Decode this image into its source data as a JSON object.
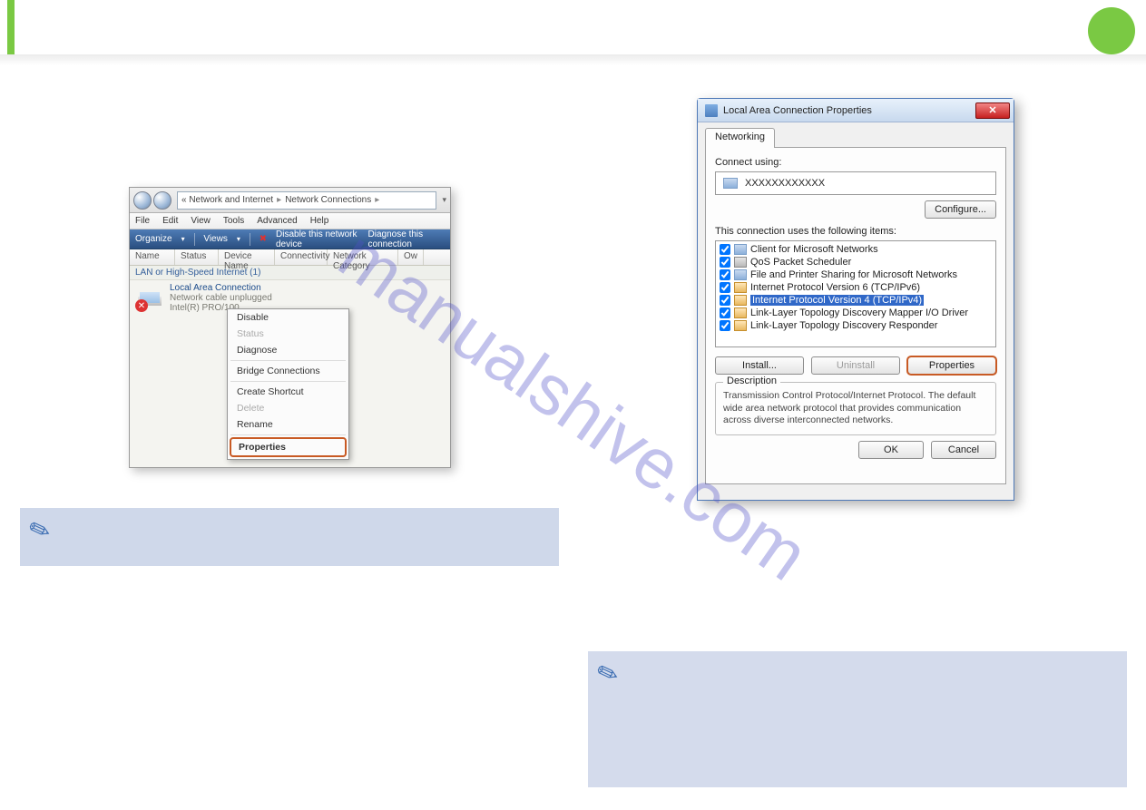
{
  "watermark": "manualshive.com",
  "left_window": {
    "breadcrumb": [
      "« Network and Internet",
      "Network Connections"
    ],
    "menus": [
      "File",
      "Edit",
      "View",
      "Tools",
      "Advanced",
      "Help"
    ],
    "toolbar": {
      "organize": "Organize",
      "views": "Views",
      "disable": "Disable this network device",
      "diagnose": "Diagnose this connection"
    },
    "columns": [
      "Name",
      "Status",
      "Device Name",
      "Connectivity",
      "Network Category",
      "Ow"
    ],
    "group": "LAN or High-Speed Internet (1)",
    "connection": {
      "name": "Local Area Connection",
      "status": "Network cable unplugged",
      "device": "Intel(R) PRO/100"
    },
    "context_menu": {
      "disable": "Disable",
      "status": "Status",
      "diagnose": "Diagnose",
      "bridge": "Bridge Connections",
      "shortcut": "Create Shortcut",
      "delete": "Delete",
      "rename": "Rename",
      "properties": "Properties"
    }
  },
  "dialog": {
    "title": "Local Area Connection Properties",
    "tab": "Networking",
    "connect_using_label": "Connect using:",
    "adapter": "XXXXXXXXXXXX",
    "configure": "Configure...",
    "items_label": "This connection uses the following items:",
    "items": [
      {
        "label": "Client for Microsoft Networks",
        "icon": "client"
      },
      {
        "label": "QoS Packet Scheduler",
        "icon": "sched"
      },
      {
        "label": "File and Printer Sharing for Microsoft Networks",
        "icon": "client"
      },
      {
        "label": "Internet Protocol Version 6 (TCP/IPv6)",
        "icon": "proto"
      },
      {
        "label": "Internet Protocol Version 4 (TCP/IPv4)",
        "icon": "proto"
      },
      {
        "label": "Link-Layer Topology Discovery Mapper I/O Driver",
        "icon": "proto"
      },
      {
        "label": "Link-Layer Topology Discovery Responder",
        "icon": "proto"
      }
    ],
    "install": "Install...",
    "uninstall": "Uninstall",
    "properties": "Properties",
    "description_label": "Description",
    "description": "Transmission Control Protocol/Internet Protocol. The default wide area network protocol that provides communication across diverse interconnected networks.",
    "ok": "OK",
    "cancel": "Cancel"
  }
}
